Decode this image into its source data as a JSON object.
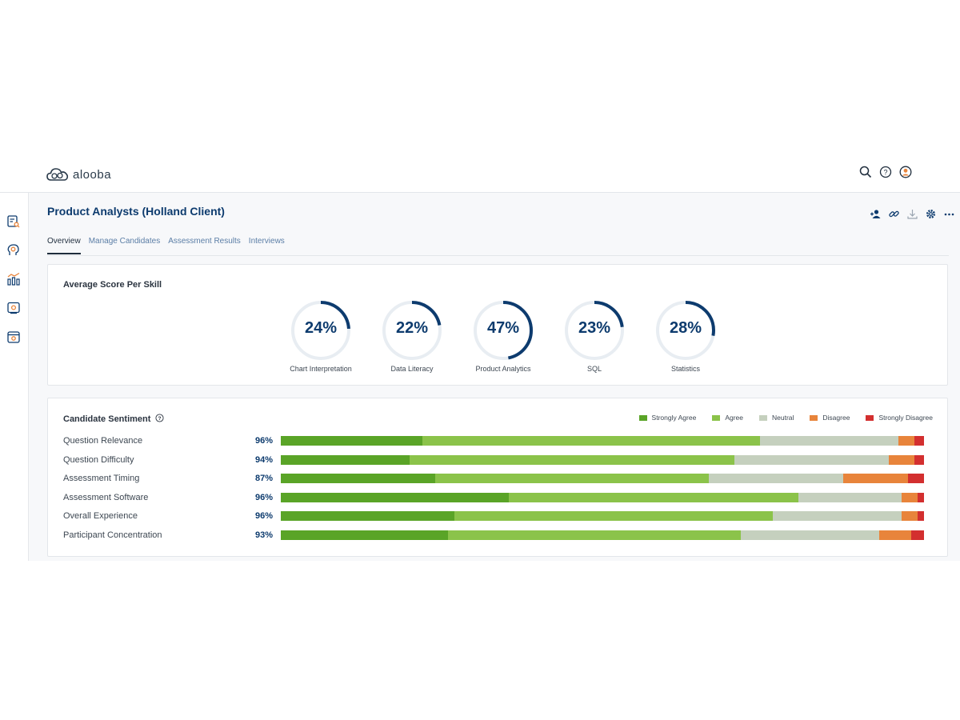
{
  "app": {
    "logo_text": "alooba"
  },
  "header": {
    "icons": [
      "search-icon",
      "help-icon",
      "user-icon"
    ]
  },
  "sidebar": {
    "icons": [
      "candidates-search-icon",
      "brain-icon",
      "analytics-icon",
      "assessment-icon",
      "calendar-icon"
    ]
  },
  "page": {
    "title": "Product Analysts (Holland Client)",
    "actions": [
      "add-user-icon",
      "link-icon",
      "download-icon",
      "settings-icon",
      "more-icon"
    ]
  },
  "tabs": [
    {
      "label": "Overview",
      "active": true
    },
    {
      "label": "Manage Candidates",
      "active": false
    },
    {
      "label": "Assessment Results",
      "active": false
    },
    {
      "label": "Interviews",
      "active": false
    }
  ],
  "skills_card": {
    "title": "Average Score Per Skill",
    "skills": [
      {
        "label": "Chart Interpretation",
        "value": 24,
        "display": "24%"
      },
      {
        "label": "Data Literacy",
        "value": 22,
        "display": "22%"
      },
      {
        "label": "Product Analytics",
        "value": 47,
        "display": "47%"
      },
      {
        "label": "SQL",
        "value": 23,
        "display": "23%"
      },
      {
        "label": "Statistics",
        "value": 28,
        "display": "28%"
      }
    ],
    "colors": {
      "arc": "#0d3b6e",
      "track": "#e8edf2"
    }
  },
  "sentiment_card": {
    "title": "Candidate Sentiment",
    "legend": [
      {
        "label": "Strongly Agree",
        "color": "#5aa427"
      },
      {
        "label": "Agree",
        "color": "#8bc34a"
      },
      {
        "label": "Neutral",
        "color": "#c5d0be"
      },
      {
        "label": "Disagree",
        "color": "#e8843b"
      },
      {
        "label": "Strongly Disagree",
        "color": "#d32f2f"
      }
    ],
    "rows": [
      {
        "label": "Question Relevance",
        "rate": "96%",
        "segments": [
          22,
          52.5,
          21.5,
          2.5,
          1.5
        ]
      },
      {
        "label": "Question Difficulty",
        "rate": "94%",
        "segments": [
          20,
          50.5,
          24,
          4,
          1.5
        ]
      },
      {
        "label": "Assessment Timing",
        "rate": "87%",
        "segments": [
          24,
          42.5,
          21,
          10,
          2.5
        ]
      },
      {
        "label": "Assessment Software",
        "rate": "96%",
        "segments": [
          35.5,
          45,
          16,
          2.5,
          1
        ]
      },
      {
        "label": "Overall Experience",
        "rate": "96%",
        "segments": [
          27,
          49.5,
          20,
          2.5,
          1
        ]
      },
      {
        "label": "Participant Concentration",
        "rate": "93%",
        "segments": [
          26,
          45.5,
          21.5,
          5,
          2
        ]
      }
    ]
  }
}
